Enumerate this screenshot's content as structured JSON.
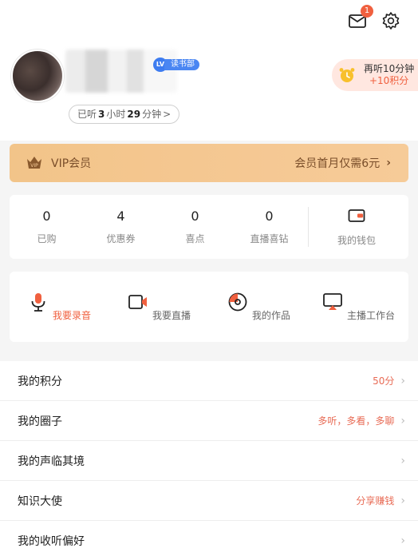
{
  "header": {
    "notification_count": "1",
    "level_badge": "LV",
    "club": "读书部",
    "listened": {
      "prefix": "已听",
      "hours": "3",
      "hours_unit": "小时",
      "minutes": "29",
      "minutes_unit": "分钟",
      "arrow": ">"
    },
    "task": {
      "title": "再听10分钟",
      "reward": "+10积分"
    }
  },
  "vip": {
    "badge": "VIP",
    "label": "VIP会员",
    "promo": "会员首月仅需6元",
    "arrow": "›"
  },
  "stats": [
    {
      "value": "0",
      "label": "已购"
    },
    {
      "value": "4",
      "label": "优惠券"
    },
    {
      "value": "0",
      "label": "喜点"
    },
    {
      "value": "0",
      "label": "直播喜钻"
    }
  ],
  "wallet": {
    "label": "我的钱包"
  },
  "tools": [
    {
      "label": "我要录音",
      "icon": "microphone-icon"
    },
    {
      "label": "我要直播",
      "icon": "video-camera-icon"
    },
    {
      "label": "我的作品",
      "icon": "disc-icon"
    },
    {
      "label": "主播工作台",
      "icon": "monitor-icon"
    }
  ],
  "menu": [
    {
      "label": "我的积分",
      "value": "50分",
      "arrow": "›"
    },
    {
      "label": "我的圈子",
      "value": "多听，多看，多聊",
      "arrow": "›"
    },
    {
      "label": "我的声临其境",
      "value": "",
      "arrow": "›"
    },
    {
      "label": "知识大使",
      "value": "分享赚钱",
      "arrow": "›"
    },
    {
      "label": "我的收听偏好",
      "value": "",
      "arrow": "›"
    }
  ],
  "colors": {
    "accent": "#f0603f",
    "vip_gradient_start": "#f2c489",
    "vip_text": "#7a4e2a",
    "level_blue": "#3d7cf0"
  }
}
